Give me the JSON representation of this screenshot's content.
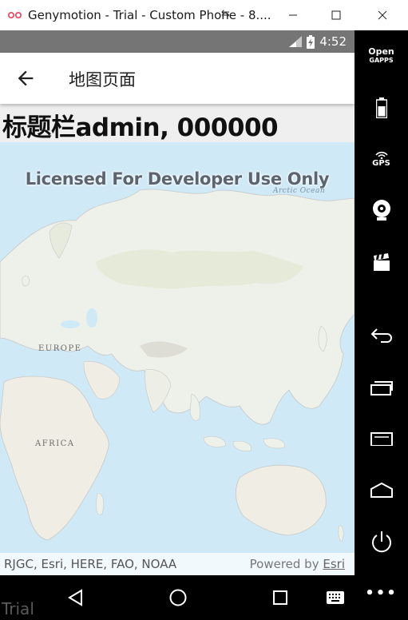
{
  "window": {
    "title": "Genymotion - Trial - Custom Phone - 8....",
    "controls": {
      "minimize": "minimize-icon",
      "maximize": "maximize-icon",
      "close": "close-icon"
    }
  },
  "status_bar": {
    "time": "4:52",
    "icons": [
      "signal-icon",
      "battery-charging-icon"
    ]
  },
  "app_bar": {
    "title": "地图页面",
    "back_icon": "arrow-back-icon"
  },
  "heading": {
    "text": "标题栏admin, 000000"
  },
  "map": {
    "watermark": "Licensed For Developer Use Only",
    "labels": {
      "arctic": "Arctic Ocean",
      "europe": "EUROPE",
      "africa": "AFRICA"
    },
    "attribution": "RJGC, Esri, HERE, FAO, NOAA",
    "powered_by_prefix": "Powered by ",
    "powered_by_link": "Esri"
  },
  "nav_bar": {
    "icons": [
      "nav-back-icon",
      "nav-home-icon",
      "nav-recents-icon",
      "keyboard-icon"
    ]
  },
  "overlay": {
    "trial": "Trial"
  },
  "sidebar": {
    "open_gapps_line1": "Open",
    "open_gapps_line2": "GAPPS",
    "gps_label": "GPS",
    "more_label": "•••"
  },
  "colors": {
    "status_bar": "#757575",
    "ocean": "#cfe9f7",
    "land": "#eef0ea",
    "sidebar": "#000000"
  }
}
